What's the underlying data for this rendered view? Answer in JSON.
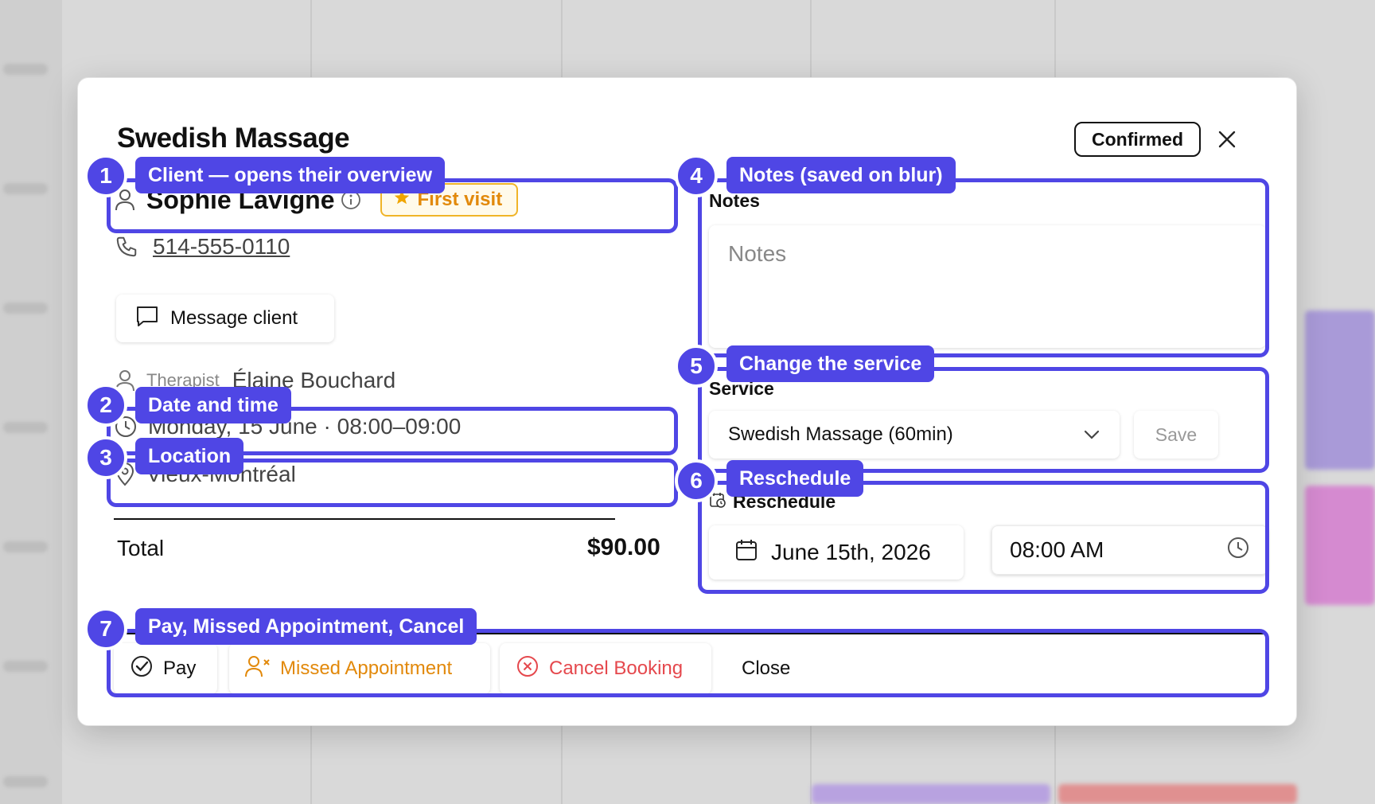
{
  "modal": {
    "title": "Swedish Massage",
    "status": "Confirmed",
    "close_icon": "close-icon"
  },
  "client": {
    "name": "Sophie Lavigne",
    "badge": "First visit",
    "phone": "514-555-0110",
    "message_button": "Message client"
  },
  "therapist": {
    "label": "Therapist",
    "name": "Élaine Bouchard"
  },
  "appointment": {
    "datetime": "Monday, 15 June · 08:00–09:00",
    "location": "Vieux-Montréal"
  },
  "total": {
    "label": "Total",
    "value": "$90.00"
  },
  "notes": {
    "label": "Notes",
    "placeholder": "Notes"
  },
  "service": {
    "label": "Service",
    "selected": "Swedish Massage (60min)",
    "save_label": "Save"
  },
  "reschedule": {
    "label": "Reschedule",
    "date": "June 15th, 2026",
    "time": "08:00 AM"
  },
  "actions": {
    "pay": "Pay",
    "missed": "Missed Appointment",
    "cancel": "Cancel Booking",
    "close": "Close"
  },
  "annotations": [
    {
      "number": "1",
      "label": "Client — opens their overview"
    },
    {
      "number": "2",
      "label": "Date and time"
    },
    {
      "number": "3",
      "label": "Location"
    },
    {
      "number": "4",
      "label": "Notes (saved on blur)"
    },
    {
      "number": "5",
      "label": "Change the service"
    },
    {
      "number": "6",
      "label": "Reschedule"
    },
    {
      "number": "7",
      "label": "Pay, Missed Appointment, Cancel"
    }
  ],
  "colors": {
    "accent": "#4f46e5",
    "warning": "#e2890b",
    "danger": "#e5484d"
  }
}
